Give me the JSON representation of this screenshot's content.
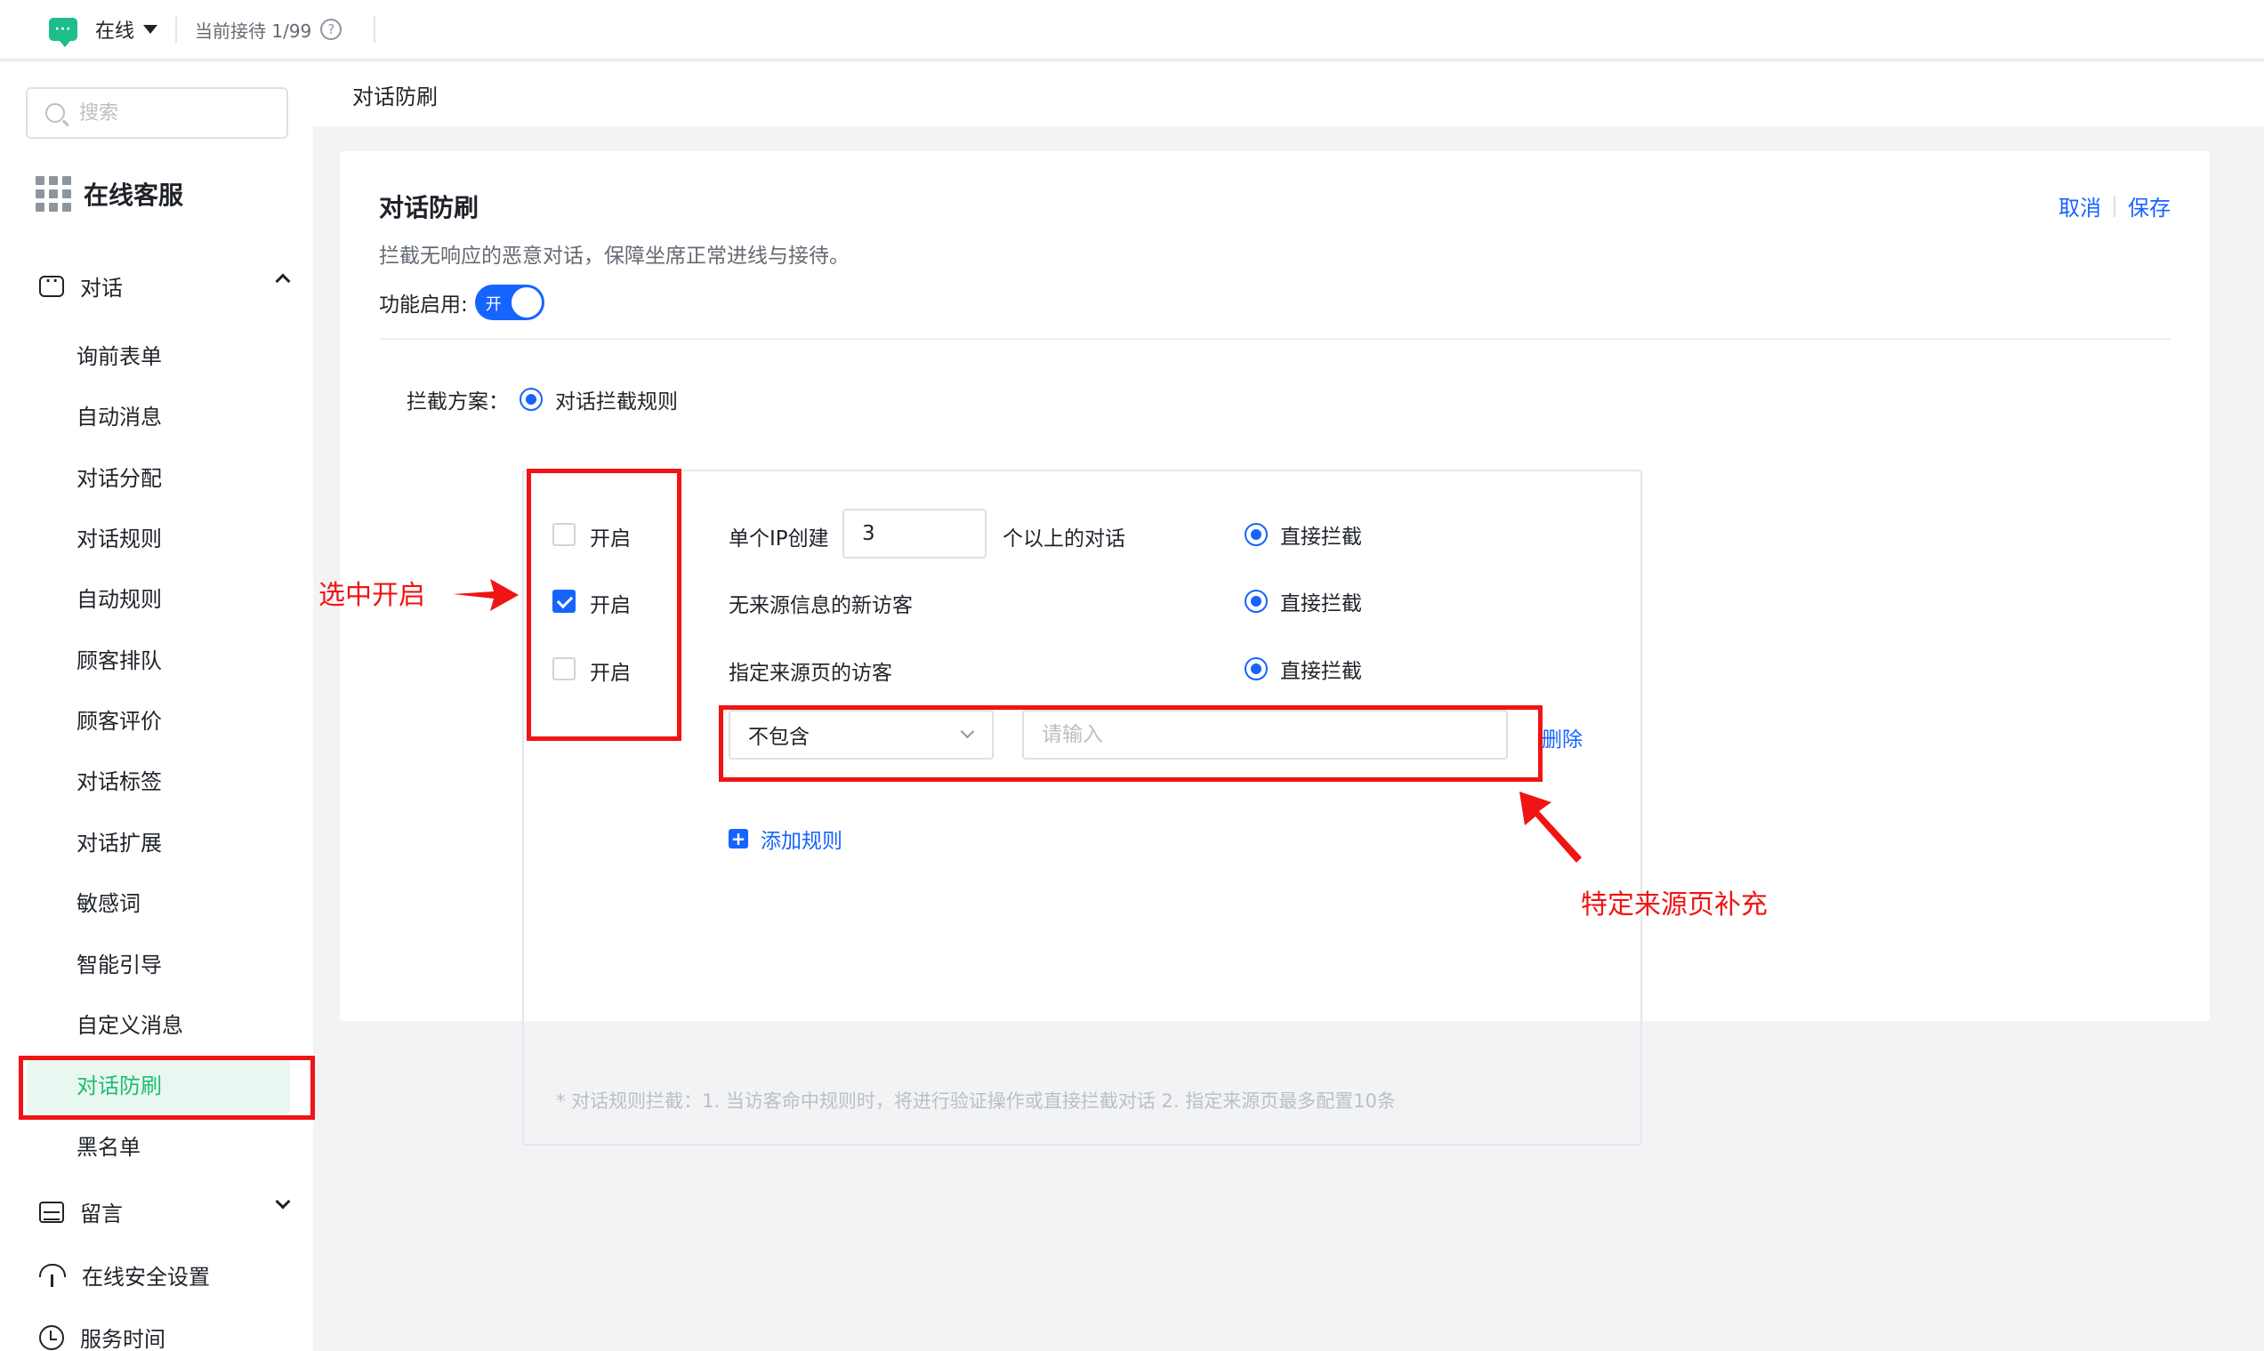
{
  "topbar": {
    "status_icon_text": "···",
    "status": "在线",
    "reception": "当前接待 1/99",
    "help_icon_text": "?"
  },
  "sidebar": {
    "search_placeholder": "搜索",
    "brand": "在线客服",
    "group_dialog": "对话",
    "items": [
      "询前表单",
      "自动消息",
      "对话分配",
      "对话规则",
      "自动规则",
      "顾客排队",
      "顾客评价",
      "对话标签",
      "对话扩展",
      "敏感词",
      "智能引导",
      "自定义消息",
      "对话防刷",
      "黑名单"
    ],
    "active_item": "对话防刷",
    "group_message": "留言",
    "group_security": "在线安全设置",
    "group_service_time": "服务时间"
  },
  "page": {
    "breadcrumb": "对话防刷"
  },
  "card": {
    "title": "对话防刷",
    "cancel": "取消",
    "save": "保存",
    "description": "拦截无响应的恶意对话，保障坐席正常进线与接待。",
    "enable_label": "功能启用:",
    "toggle_text": "开",
    "toggle_on": true,
    "scheme_label": "拦截方案：",
    "scheme_option": "对话拦截规则"
  },
  "rules": [
    {
      "enable_label": "开启",
      "checked": false,
      "text_before": "单个IP创建",
      "input_value": "3",
      "text_after": "个以上的对话",
      "action": "直接拦截"
    },
    {
      "enable_label": "开启",
      "checked": true,
      "text_before": "无来源信息的新访客",
      "action": "直接拦截"
    },
    {
      "enable_label": "开启",
      "checked": false,
      "text_before": "指定来源页的访客",
      "action": "直接拦截"
    }
  ],
  "source_rule": {
    "select_value": "不包含",
    "input_placeholder": "请输入",
    "delete": "删除"
  },
  "add_rule": "添加规则",
  "plus_icon_text": "+",
  "note": "* 对话规则拦截：1. 当访客命中规则时，将进行验证操作或直接拦截对话 2. 指定来源页最多配置10条",
  "annotations": {
    "select_enable": "选中开启",
    "source_supplement": "特定来源页补充"
  },
  "colors": {
    "primary": "#1664ff",
    "online_green": "#1ebd8c",
    "active_green": "#1ebd72",
    "annotation_red": "#f01414"
  }
}
